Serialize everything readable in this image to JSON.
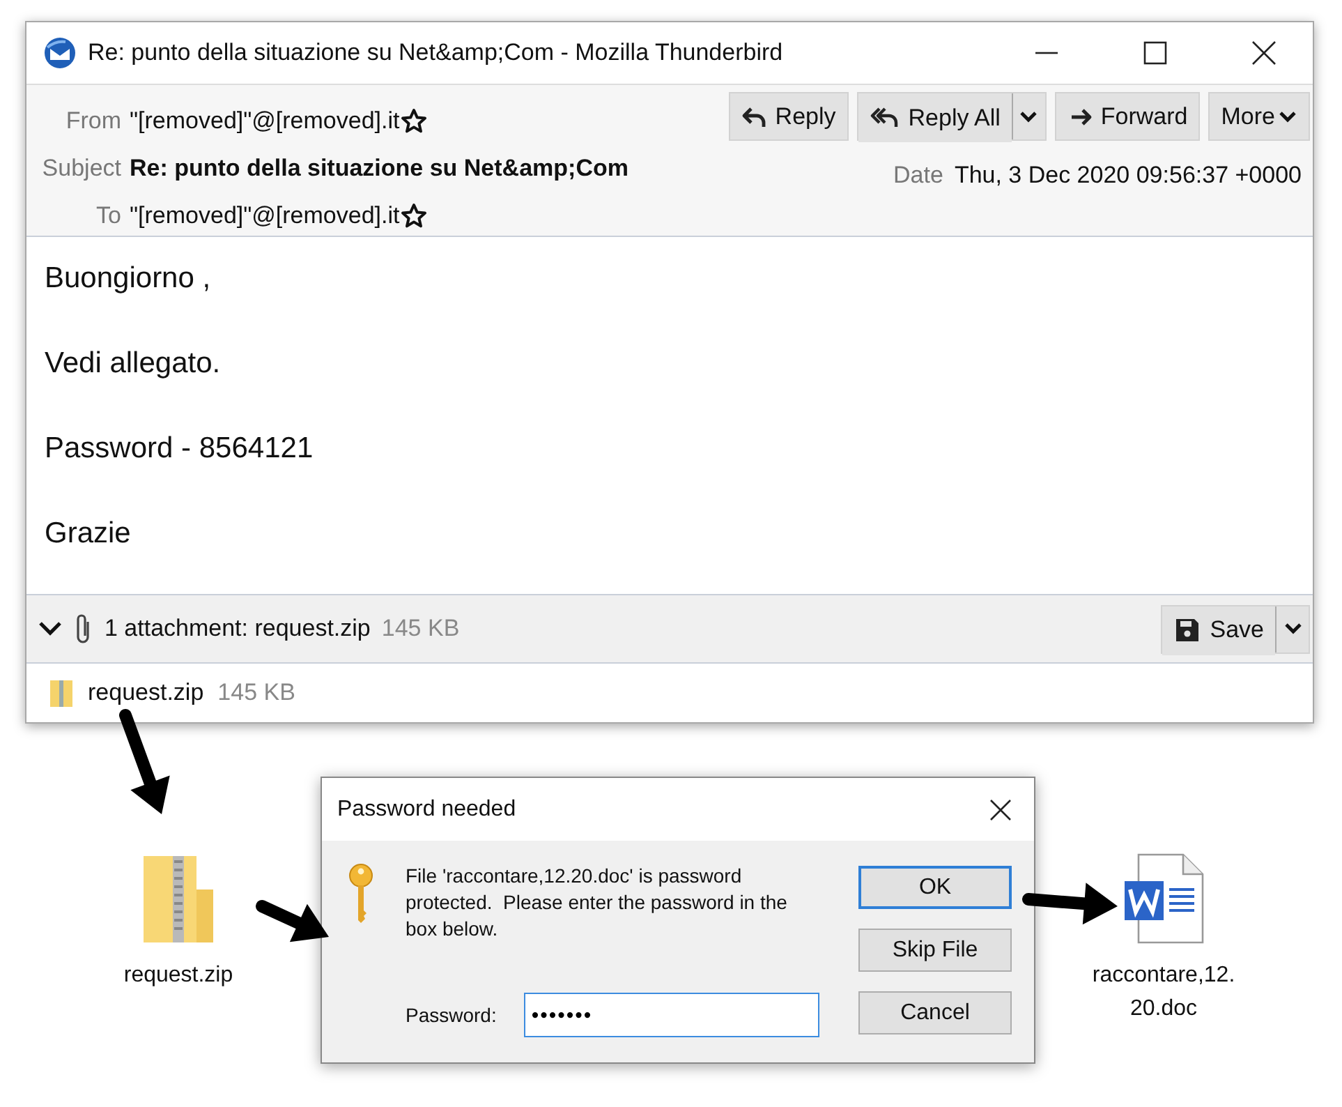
{
  "window": {
    "title": "Re: punto della situazione su Net&amp;Com - Mozilla Thunderbird"
  },
  "header": {
    "fields": [
      {
        "label": "From",
        "value": "\"[removed]\"@[removed].it",
        "kind": "address"
      },
      {
        "label": "Subject",
        "value": "Re: punto della situazione su Net&amp;Com",
        "kind": "subject"
      },
      {
        "label": "To",
        "value": "\"[removed]\"@[removed].it",
        "kind": "address"
      }
    ],
    "buttons": [
      {
        "label": "Reply",
        "kind": "reply"
      },
      {
        "label": "Reply All",
        "kind": "reply-all"
      },
      {
        "label": "Forward",
        "kind": "forward"
      },
      {
        "label": "More",
        "kind": "more"
      }
    ],
    "date": {
      "label": "Date",
      "value": "Thu, 3 Dec 2020 09:56:37 +0000"
    }
  },
  "body": {
    "paragraphs": [
      "Buongiorno ,",
      "Vedi allegato.",
      "Password - 8564121",
      "Grazie"
    ]
  },
  "attachment_bar": {
    "summary": "1 attachment: request.zip",
    "size": "145 KB",
    "save_button": "Save"
  },
  "attachments": [
    {
      "name": "request.zip",
      "size": "145 KB"
    }
  ],
  "desktop": {
    "files": [
      {
        "name": "request.zip",
        "kind": "zip"
      },
      {
        "name": "raccontare,12.20.doc",
        "kind": "word"
      }
    ]
  },
  "dialog": {
    "title": "Password needed",
    "message": "File 'raccontare,12.20.doc' is password protected.  Please enter the password in the box below.",
    "field": {
      "label": "Password:",
      "value": "•••••••"
    },
    "buttons": [
      {
        "label": "OK",
        "default": true
      },
      {
        "label": "Skip File",
        "default": false
      },
      {
        "label": "Cancel",
        "default": false
      }
    ]
  }
}
